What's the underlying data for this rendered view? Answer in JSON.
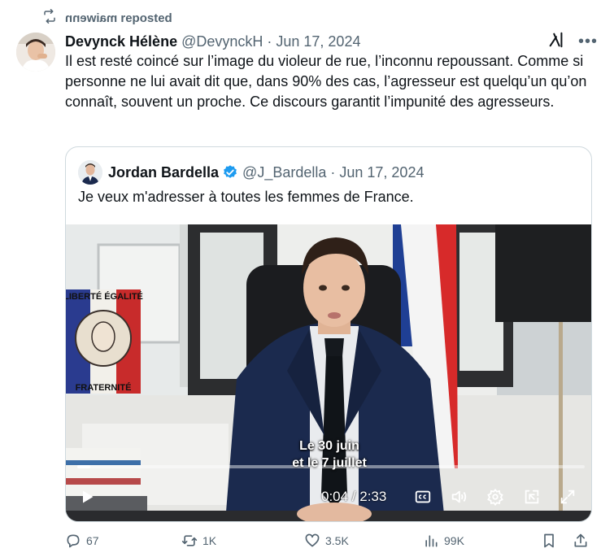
{
  "repost": {
    "reposter": "maiwenn",
    "suffix": "reposted"
  },
  "post": {
    "author_name": "Devynck Hélène",
    "handle": "@DevynckH",
    "separator": "·",
    "date": "Jun 17, 2024",
    "text": "Il est resté coincé sur l’image du violeur de rue, l’inconnu repoussant. Comme si personne ne lui avait dit que, dans 90% des cas, l’agresseur est quelqu’un qu’on connaît, souvent un proche. Ce discours garantit l’impunité des agresseurs."
  },
  "quote": {
    "author_name": "Jordan Bardella",
    "handle": "@J_Bardella",
    "separator": "·",
    "date": "Jun 17, 2024",
    "text": "Je veux m'adresser à toutes les femmes de France.",
    "video": {
      "subtitle_line1": "Le 30 juin",
      "subtitle_line2": "et le 7 juillet",
      "time": "0:04 / 2:33",
      "progress": 0.026,
      "poster_text_top": "LIBERTÉ ÉGALITÉ",
      "poster_text_bottom": "FRATERNITÉ"
    }
  },
  "actions": {
    "replies": "67",
    "reposts": "1K",
    "likes": "3.5K",
    "views": "99K"
  },
  "colors": {
    "text": "#0f1419",
    "muted": "#536471",
    "border": "#cfd9de",
    "verified": "#1d9bf0",
    "suit": "#1b2a4e"
  },
  "icons": {
    "repost": "repost-icon",
    "grok": "grok-icon",
    "more": "more-icon",
    "verified": "verified-badge-icon",
    "play": "play-icon",
    "cc": "captions-icon",
    "volume": "volume-icon",
    "settings": "settings-icon",
    "pip": "picture-in-picture-icon",
    "fullscreen": "fullscreen-icon",
    "reply": "reply-icon",
    "retweet": "retweet-icon",
    "like": "heart-icon",
    "views": "views-icon",
    "bookmark": "bookmark-icon",
    "share": "share-icon"
  }
}
